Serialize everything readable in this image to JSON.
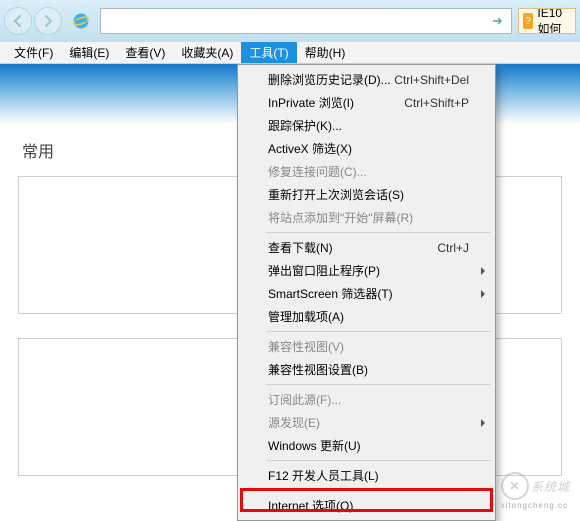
{
  "titlebar": {
    "tab_label": "IE10如何"
  },
  "menubar": {
    "file": "文件(F)",
    "edit": "编辑(E)",
    "view": "查看(V)",
    "favorites": "收藏夹(A)",
    "tools": "工具(T)",
    "help": "帮助(H)"
  },
  "page": {
    "section_title": "常用"
  },
  "dropdown": {
    "delete_history": "删除浏览历史记录(D)...",
    "delete_history_sc": "Ctrl+Shift+Del",
    "inprivate": "InPrivate 浏览(I)",
    "inprivate_sc": "Ctrl+Shift+P",
    "tracking": "跟踪保护(K)...",
    "activex": "ActiveX 筛选(X)",
    "fix_conn": "修复连接问题(C)...",
    "reopen_session": "重新打开上次浏览会话(S)",
    "add_to_start": "将站点添加到\"开始\"屏幕(R)",
    "view_downloads": "查看下载(N)",
    "view_downloads_sc": "Ctrl+J",
    "popup_blocker": "弹出窗口阻止程序(P)",
    "smartscreen": "SmartScreen 筛选器(T)",
    "manage_addons": "管理加载项(A)",
    "compat_view": "兼容性视图(V)",
    "compat_settings": "兼容性视图设置(B)",
    "subscribe_feed": "订阅此源(F)...",
    "feed_discovery": "源发现(E)",
    "windows_update": "Windows 更新(U)",
    "f12_tools": "F12 开发人员工具(L)",
    "internet_options": "Internet 选项(O)"
  },
  "watermark": {
    "text": "系统城",
    "sub": "xitongcheng.cc"
  }
}
